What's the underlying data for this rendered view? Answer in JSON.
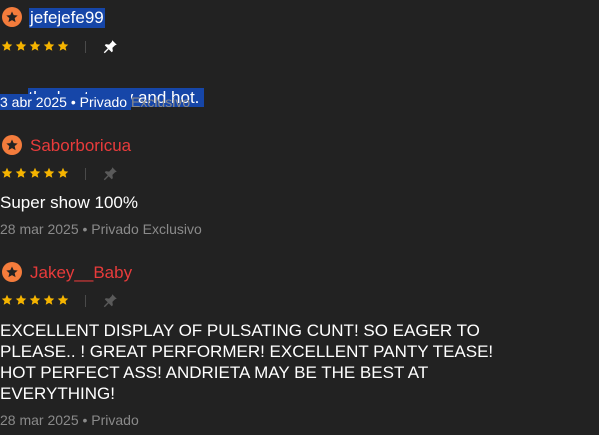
{
  "colors": {
    "background": "#222222",
    "badge": "#f47c3c",
    "username_red": "#e83b3b",
    "star": "#f5b400",
    "meta": "#8a8a8a",
    "selection": "#1646a8"
  },
  "reviews": [
    {
      "username": "jefejefe99",
      "rating": 5,
      "rating_max": 5,
      "comment": "the best. sexy and hot. ",
      "meta_highlighted": "3 abr 2025 • Privado ",
      "meta_rest": "Exclusivo",
      "badge_icon": "star-badge-icon",
      "pin_icon": "pin-icon"
    },
    {
      "username": "Saborboricua",
      "rating": 5,
      "rating_max": 5,
      "comment": "Super show 100%",
      "meta": "28 mar 2025 • Privado Exclusivo",
      "badge_icon": "star-badge-icon",
      "pin_icon": "pin-icon"
    },
    {
      "username": "Jakey__Baby",
      "rating": 5,
      "rating_max": 5,
      "comment": "EXCELLENT DISPLAY OF PULSATING CUNT! SO EAGER TO\nPLEASE.. ! GREAT PERFORMER! EXCELLENT PANTY TEASE!\nHOT PERFECT ASS! ANDRIETA MAY BE THE BEST AT\nEVERYTHING!",
      "meta": "28 mar 2025 • Privado",
      "badge_icon": "star-badge-icon",
      "pin_icon": "pin-icon"
    }
  ]
}
